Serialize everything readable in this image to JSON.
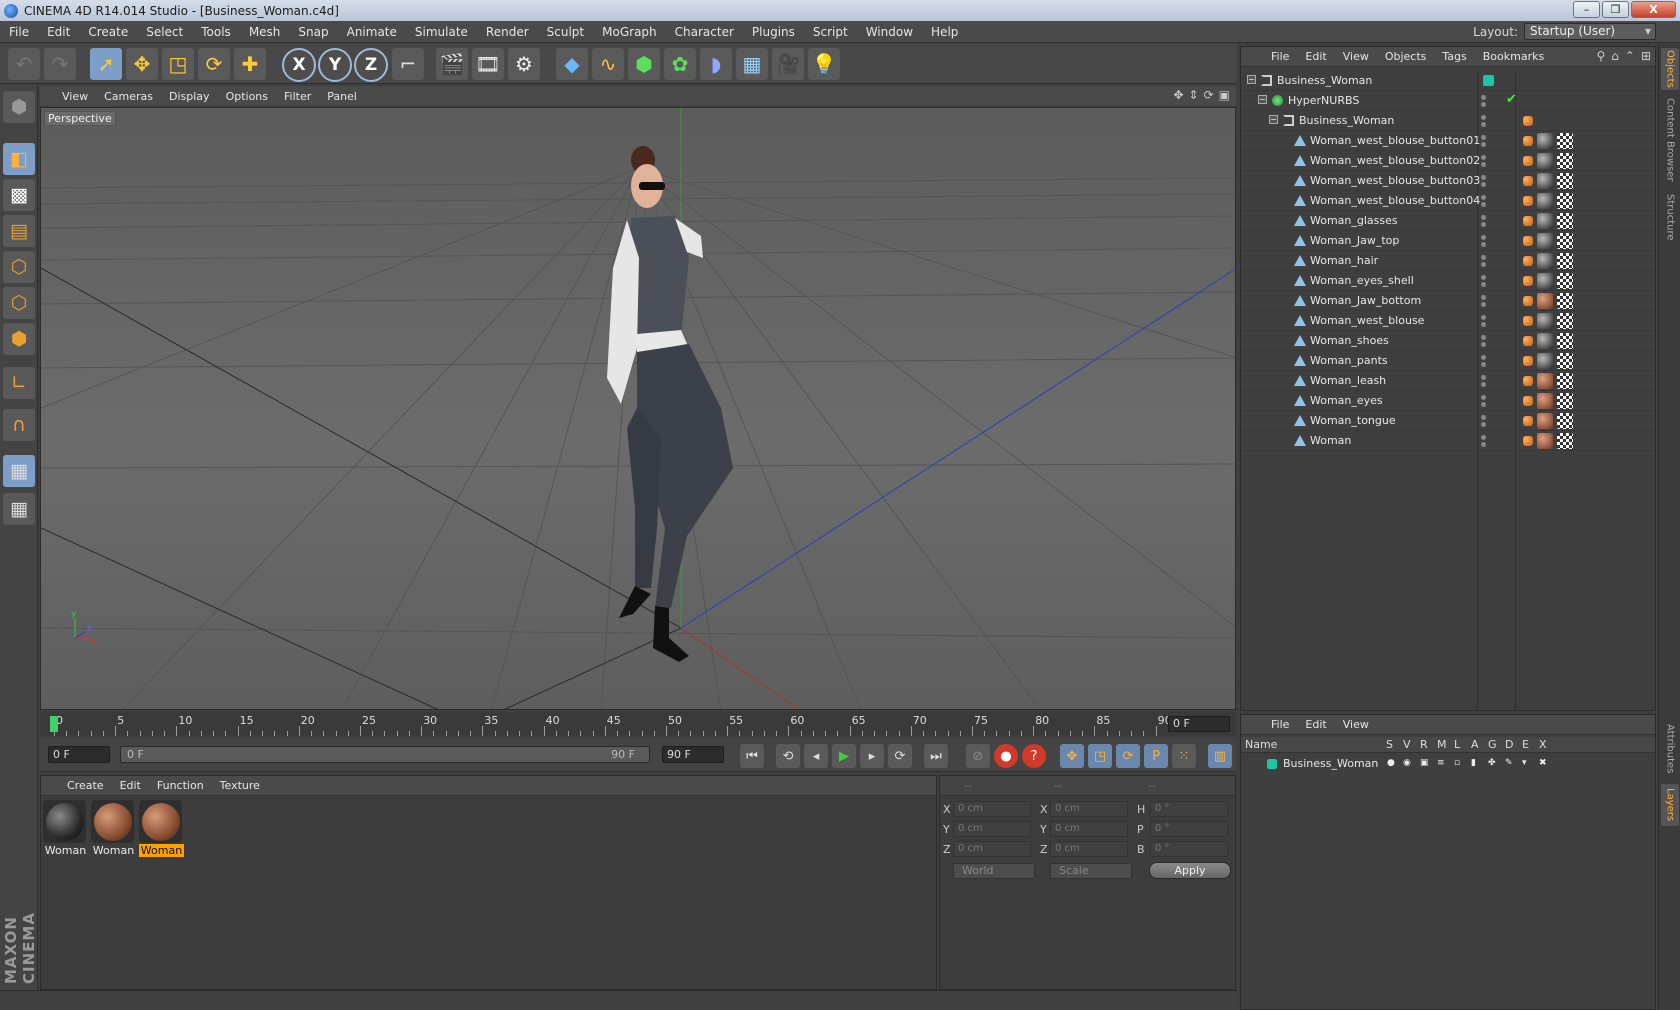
{
  "window": {
    "title": "CINEMA 4D R14.014 Studio - [Business_Woman.c4d]",
    "minimize": "–",
    "maximize": "❐",
    "close": "X"
  },
  "menubar": {
    "items": [
      "File",
      "Edit",
      "Create",
      "Select",
      "Tools",
      "Mesh",
      "Snap",
      "Animate",
      "Simulate",
      "Render",
      "Sculpt",
      "MoGraph",
      "Character",
      "Plugins",
      "Script",
      "Window",
      "Help"
    ],
    "layout_label": "Layout:",
    "layout_value": "Startup (User)"
  },
  "toolbar": {
    "x_label": "X",
    "y_label": "Y",
    "z_label": "Z"
  },
  "viewport": {
    "menu": [
      "View",
      "Cameras",
      "Display",
      "Options",
      "Filter",
      "Panel"
    ],
    "label": "Perspective",
    "axis_y": "y",
    "axis_z": "z",
    "axis_x": "x"
  },
  "timeline": {
    "ticks": [
      "0",
      "5",
      "10",
      "15",
      "20",
      "25",
      "30",
      "35",
      "40",
      "45",
      "50",
      "55",
      "60",
      "65",
      "70",
      "75",
      "80",
      "85",
      "90"
    ],
    "current_frame": "0 F"
  },
  "playback": {
    "start": "0 F",
    "range_start": "0 F",
    "range_end": "90 F",
    "end": "90 F"
  },
  "materials": {
    "menu": [
      "Create",
      "Edit",
      "Function",
      "Texture"
    ],
    "items": [
      {
        "label": "Woman",
        "selected": false
      },
      {
        "label": "Woman",
        "selected": false
      },
      {
        "label": "Woman",
        "selected": true
      }
    ]
  },
  "coordinates": {
    "head": [
      "--",
      "--",
      "--"
    ],
    "rows": [
      {
        "a": "X",
        "av": "0 cm",
        "b": "X",
        "bv": "0 cm",
        "c": "H",
        "cv": "0 °"
      },
      {
        "a": "Y",
        "av": "0 cm",
        "b": "Y",
        "bv": "0 cm",
        "c": "P",
        "cv": "0 °"
      },
      {
        "a": "Z",
        "av": "0 cm",
        "b": "Z",
        "bv": "0 cm",
        "c": "B",
        "cv": "0 °"
      }
    ],
    "mode": "World",
    "type": "Scale",
    "apply": "Apply"
  },
  "objects": {
    "menu": [
      "File",
      "Edit",
      "View",
      "Objects",
      "Tags",
      "Bookmarks"
    ],
    "rows": [
      {
        "name": "Business_Woman",
        "level": 0,
        "kind": "null"
      },
      {
        "name": "HyperNURBS",
        "level": 1,
        "kind": "nurbs"
      },
      {
        "name": "Business_Woman",
        "level": 2,
        "kind": "null"
      },
      {
        "name": "Woman_west_blouse_button01",
        "level": 3,
        "kind": "mesh"
      },
      {
        "name": "Woman_west_blouse_button02",
        "level": 3,
        "kind": "mesh"
      },
      {
        "name": "Woman_west_blouse_button03",
        "level": 3,
        "kind": "mesh"
      },
      {
        "name": "Woman_west_blouse_button04",
        "level": 3,
        "kind": "mesh"
      },
      {
        "name": "Woman_glasses",
        "level": 3,
        "kind": "mesh"
      },
      {
        "name": "Woman_Jaw_top",
        "level": 3,
        "kind": "mesh"
      },
      {
        "name": "Woman_hair",
        "level": 3,
        "kind": "mesh"
      },
      {
        "name": "Woman_eyes_shell",
        "level": 3,
        "kind": "mesh"
      },
      {
        "name": "Woman_Jaw_bottom",
        "level": 3,
        "kind": "mesh"
      },
      {
        "name": "Woman_west_blouse",
        "level": 3,
        "kind": "mesh"
      },
      {
        "name": "Woman_shoes",
        "level": 3,
        "kind": "mesh"
      },
      {
        "name": "Woman_pants",
        "level": 3,
        "kind": "mesh"
      },
      {
        "name": "Woman_leash",
        "level": 3,
        "kind": "mesh"
      },
      {
        "name": "Woman_eyes",
        "level": 3,
        "kind": "mesh"
      },
      {
        "name": "Woman_tongue",
        "level": 3,
        "kind": "mesh"
      },
      {
        "name": "Woman",
        "level": 3,
        "kind": "mesh"
      }
    ]
  },
  "layers": {
    "menu": [
      "File",
      "Edit",
      "View"
    ],
    "columns": [
      "Name",
      "S",
      "V",
      "R",
      "M",
      "L",
      "A",
      "G",
      "D",
      "E",
      "X"
    ],
    "row_name": "Business_Woman"
  },
  "side_tabs": [
    "Objects",
    "Content Browser",
    "Structure",
    "Attributes",
    "Layers"
  ],
  "branding": "MAXON CINEMA 4D"
}
